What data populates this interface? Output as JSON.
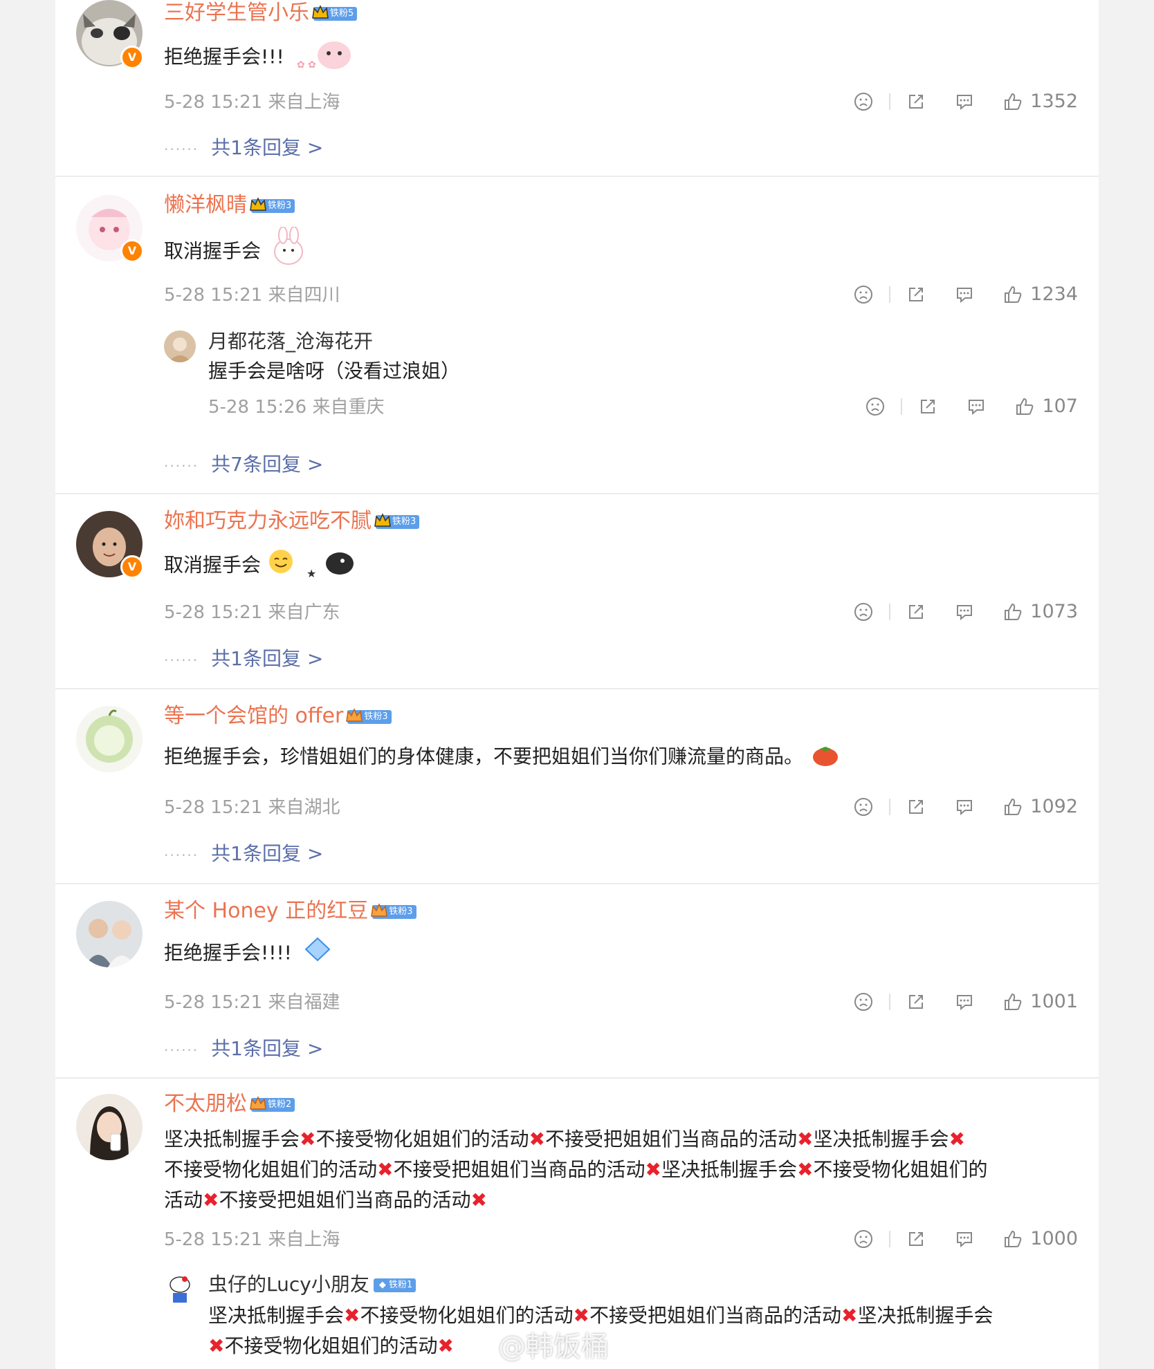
{
  "comments": [
    {
      "user": "三好学生管小乐",
      "fan_badge": "铁粉5",
      "text": "拒绝握手会!!!",
      "time": "5-28 15:21",
      "location": "来自上海",
      "likes": "1352",
      "replies": "共1条回复 >"
    },
    {
      "user": "懒洋枫晴",
      "fan_badge": "铁粉3",
      "text": "取消握手会",
      "time": "5-28 15:21",
      "location": "来自四川",
      "likes": "1234",
      "sub": {
        "user": "月都花落_沧海花开",
        "text": "握手会是啥呀（没看过浪姐）",
        "time": "5-28 15:26",
        "location": "来自重庆",
        "likes": "107"
      },
      "replies": "共7条回复 >"
    },
    {
      "user": "妳和巧克力永远吃不腻",
      "fan_badge": "铁粉3",
      "text": "取消握手会",
      "time": "5-28 15:21",
      "location": "来自广东",
      "likes": "1073",
      "replies": "共1条回复 >"
    },
    {
      "user": "等一个会馆的 offer",
      "fan_badge": "铁粉3",
      "text": "拒绝握手会，珍惜姐姐们的身体健康，不要把姐姐们当你们赚流量的商品。",
      "time": "5-28 15:21",
      "location": "来自湖北",
      "likes": "1092",
      "replies": "共1条回复 >"
    },
    {
      "user": "某个 Honey 正的红豆",
      "fan_badge": "铁粉3",
      "text": "拒绝握手会!!!!",
      "time": "5-28 15:21",
      "location": "来自福建",
      "likes": "1001",
      "replies": "共1条回复 >"
    },
    {
      "user": "不太朋松",
      "fan_badge": "铁粉2",
      "text_line1_parts": [
        "坚决抵制握手会",
        "不接受物化姐姐们的活动",
        "不接受把姐姐们当商品的活动",
        "坚决抵制握手会"
      ],
      "text_line2_parts": [
        "不接受物化姐姐们的活动",
        "不接受把姐姐们当商品的活动",
        "坚决抵制握手会",
        "不接受物化姐姐们的"
      ],
      "text_line3_parts": [
        "活动",
        "不接受把姐姐们当商品的活动"
      ],
      "time": "5-28 15:21",
      "location": "来自上海",
      "likes": "1000",
      "sub": {
        "user": "虫仔的Lucy小朋友",
        "fan_badge": "铁粉1",
        "text_line1_parts": [
          "坚决抵制握手会",
          "不接受物化姐姐们的活动",
          "不接受把姐姐们当商品的活动",
          "坚决抵制握手会"
        ],
        "text_line2_parts": [
          "不接受物化姐姐们的活动"
        ]
      }
    }
  ],
  "watermark": "@韩饭桶",
  "icons": [
    "dislike-icon",
    "share-icon",
    "comment-icon",
    "like-icon",
    "crown-icon",
    "verified-v-icon",
    "cross-mark-icon"
  ],
  "colors": {
    "username": "#eb7350",
    "reply_link": "#5b6fa8",
    "cross": "#e8222c",
    "verified": "#ff8200",
    "fan_badge": "#5c9eea"
  }
}
